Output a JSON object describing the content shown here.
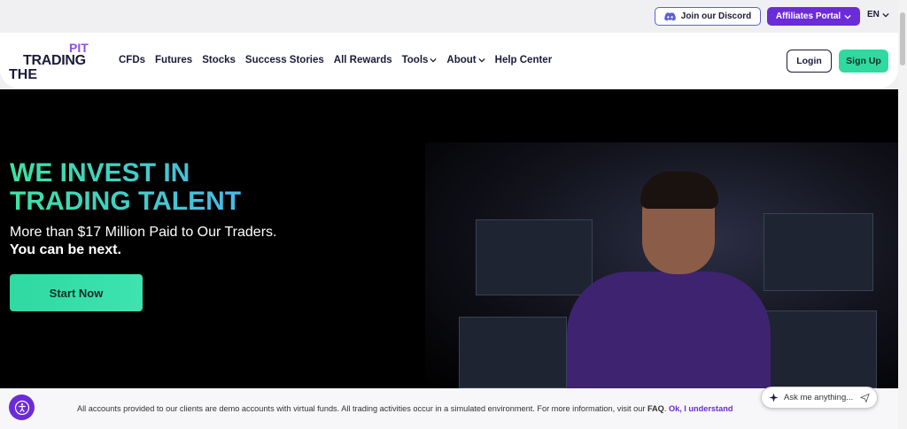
{
  "topbar": {
    "discord_label": "Join our Discord",
    "affiliates_label": "Affiliates Portal",
    "language": "EN"
  },
  "logo": {
    "pit": "PIT",
    "trading": "TRADING",
    "the": "THE"
  },
  "nav": {
    "items": [
      {
        "label": "CFDs",
        "has_dropdown": false
      },
      {
        "label": "Futures",
        "has_dropdown": false
      },
      {
        "label": "Stocks",
        "has_dropdown": false
      },
      {
        "label": "Success Stories",
        "has_dropdown": false
      },
      {
        "label": "All Rewards",
        "has_dropdown": false
      },
      {
        "label": "Tools",
        "has_dropdown": true
      },
      {
        "label": "About",
        "has_dropdown": true
      },
      {
        "label": "Help Center",
        "has_dropdown": false
      }
    ],
    "login_label": "Login",
    "signup_label": "Sign Up"
  },
  "hero": {
    "headline_line1": "WE INVEST IN",
    "headline_line2": "TRADING TALENT",
    "sub_line1": "More than $17 Million Paid to Our Traders.",
    "sub_line2": "You can be next.",
    "cta_label": "Start Now"
  },
  "notice": {
    "text": "All accounts provided to our clients are demo accounts with virtual funds. All trading activities occur in a simulated environment. For more information, visit our ",
    "faq_label": "FAQ",
    "ok_label": "Ok, I understand"
  },
  "assistant": {
    "placeholder": "Ask me anything..."
  },
  "colors": {
    "brand_purple": "#6c2bd9",
    "accent_green": "#2fd9a0",
    "navy": "#1b1b3a"
  }
}
